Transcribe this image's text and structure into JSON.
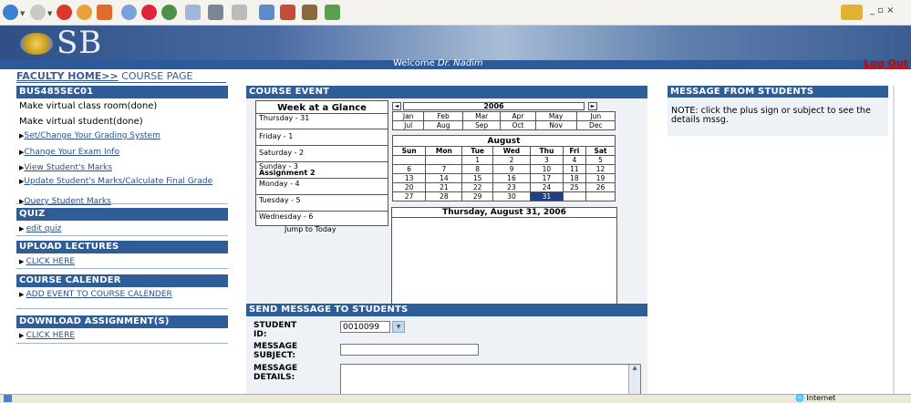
{
  "colors": {
    "header_blue": "#2f5d98",
    "logout_red": "#cc0000",
    "link_blue": "#2d4f8a",
    "selected_day": "#1f3f8c"
  },
  "banner": {
    "logo_text": "SB"
  },
  "welcome": {
    "prefix": "Welcome ",
    "name": "Dr. Nadim",
    "logout": "Log Out"
  },
  "breadcrumb": {
    "home": "FACULTY HOME>>",
    "current": " COURSE PAGE"
  },
  "left": {
    "course": {
      "title": "BUS485SEC01",
      "items": [
        "Make virtual class room(done)",
        "Make virtual student(done)"
      ],
      "links": [
        "Set/Change Your Grading System",
        "Change Your Exam Info",
        "View Student's Marks",
        "Update Student's Marks/Calculate Final Grade",
        "Query Student Marks"
      ]
    },
    "quiz": {
      "title": "QUIZ",
      "link": "edit quiz"
    },
    "upload": {
      "title": "UPLOAD LECTURES",
      "link": "CLICK HERE"
    },
    "calendar": {
      "title": "COURSE CALENDER",
      "link": "ADD EVENT TO COURSE CALENDER"
    },
    "download": {
      "title": "DOWNLOAD ASSIGNMENT(S)",
      "link": "CLICK HERE"
    }
  },
  "event": {
    "title": "COURSE EVENT",
    "week_title": "Week at a Glance",
    "days": [
      "Thursday - 31",
      "Friday - 1",
      "Saturday - 2",
      "Sunday - 3",
      "Monday - 4",
      "Tuesday - 5",
      "Wednesday - 6"
    ],
    "sunday_note": "Assignment 2",
    "jump": "Jump to Today",
    "year": "2006",
    "prev": "◄",
    "next": "►",
    "months_row1": [
      "Jan",
      "Feb",
      "Mar",
      "Apr",
      "May",
      "Jun"
    ],
    "months_row2": [
      "Jul",
      "Aug",
      "Sep",
      "Oct",
      "Nov",
      "Dec"
    ],
    "month_title": "August",
    "weekdays": [
      "Sun",
      "Mon",
      "Tue",
      "Wed",
      "Thu",
      "Fri",
      "Sat"
    ],
    "weeks": [
      [
        "",
        "",
        "1",
        "2",
        "3",
        "4",
        "5"
      ],
      [
        "6",
        "7",
        "8",
        "9",
        "10",
        "11",
        "12"
      ],
      [
        "13",
        "14",
        "15",
        "16",
        "17",
        "18",
        "19"
      ],
      [
        "20",
        "21",
        "22",
        "23",
        "24",
        "25",
        "26"
      ],
      [
        "27",
        "28",
        "29",
        "30",
        "31",
        "",
        ""
      ]
    ],
    "selected": "31",
    "date_heading": "Thursday, August 31, 2006"
  },
  "messages": {
    "title": "MESSAGE FROM STUDENTS",
    "note": "NOTE: click the plus sign or subject to see the details mssg."
  },
  "send": {
    "title": "SEND MESSAGE TO STUDENTS",
    "student_label": "STUDENT ID:",
    "student_value": "0010099",
    "subject_label": "MESSAGE SUBJECT:",
    "details_label": "MESSAGE DETAILS:",
    "subject_value": "",
    "details_value": ""
  },
  "status": {
    "zone": "Internet"
  }
}
